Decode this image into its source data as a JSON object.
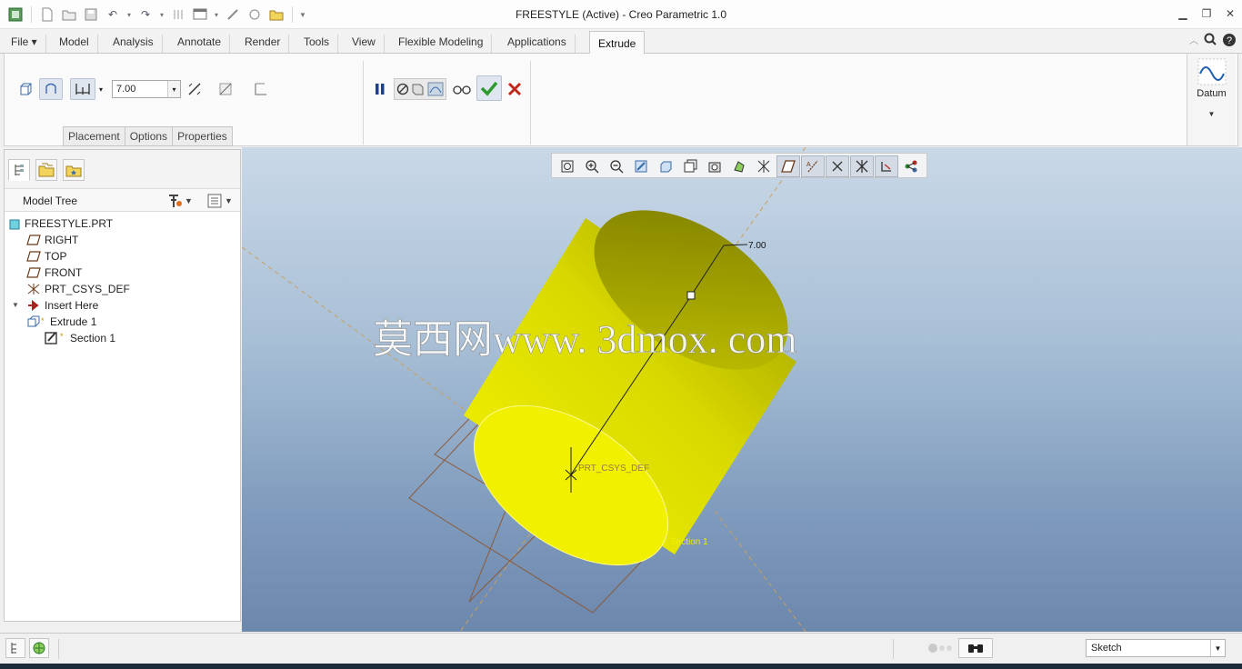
{
  "window": {
    "title": "FREESTYLE (Active) - Creo Parametric 1.0",
    "controls": [
      "minimize-icon",
      "restore-icon",
      "close-icon"
    ]
  },
  "quick_access": [
    "new-icon",
    "open-icon",
    "save-icon",
    "undo-icon",
    "redo-icon",
    "regenerate-icon",
    "windows-icon",
    "close-window-icon",
    "customize-icon"
  ],
  "ribbon": {
    "file_label": "File",
    "tabs": [
      "Model",
      "Analysis",
      "Annotate",
      "Render",
      "Tools",
      "View",
      "Flexible Modeling",
      "Applications"
    ],
    "active_tab": "Extrude",
    "extrude": {
      "depth_value": "7.00",
      "subtabs": [
        "Placement",
        "Options",
        "Properties"
      ]
    },
    "datum_label": "Datum"
  },
  "model_tree": {
    "header": "Model Tree",
    "items": [
      {
        "label": "FREESTYLE.PRT",
        "icon": "part-icon"
      },
      {
        "label": "RIGHT",
        "icon": "datum-plane-icon"
      },
      {
        "label": "TOP",
        "icon": "datum-plane-icon"
      },
      {
        "label": "FRONT",
        "icon": "datum-plane-icon"
      },
      {
        "label": "PRT_CSYS_DEF",
        "icon": "csys-icon"
      },
      {
        "label": "Insert Here",
        "icon": "insert-arrow-icon"
      },
      {
        "label": "Extrude 1",
        "icon": "extrude-icon"
      },
      {
        "label": "Section 1",
        "icon": "sketch-icon"
      }
    ]
  },
  "viewport": {
    "dimension_label": "7.00",
    "csys_label": "PRT_CSYS_DEF",
    "section_label": "Section 1",
    "watermark": "莫西网www. 3dmox. com"
  },
  "statusbar": {
    "filter_value": "Sketch"
  },
  "colors": {
    "feature_yellow": "#e8e800",
    "viewport_top": "#c9d8e7",
    "viewport_bottom": "#6c87ac",
    "confirm_green": "#2f9a2f",
    "cancel_red": "#c0281e"
  }
}
